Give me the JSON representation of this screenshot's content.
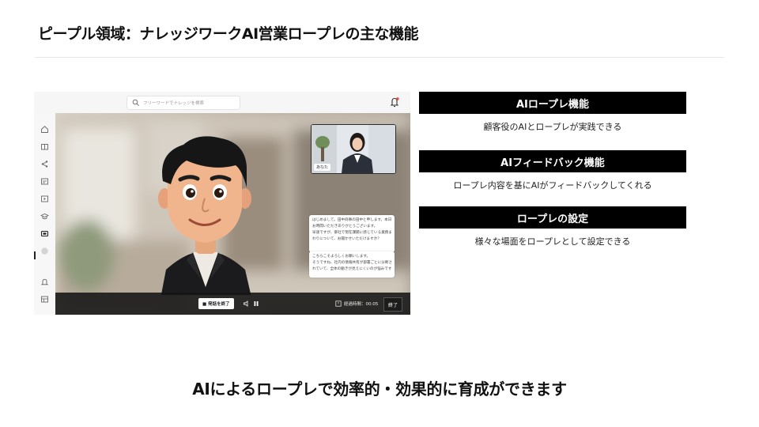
{
  "slide": {
    "title": "ピープル領域：ナレッジワークAI営業ロープレの主な機能",
    "bottom_message": "AIによるロープレで効率的・効果的に育成ができます"
  },
  "app": {
    "search_placeholder": "フリーワードでナレッジを検索",
    "sidebar_icons": [
      "home-icon",
      "book-icon",
      "share-icon",
      "list-icon",
      "play-icon",
      "graduation-icon",
      "roleplay-icon",
      "profile-icon",
      "bell-icon",
      "grid-icon"
    ],
    "pip_label": "あなた",
    "chat": {
      "ai_message": [
        "はじめまして。田中商事の田中と申します。本日は",
        "お時間いただきありがとうございます。",
        "早速ですが、御社で現在課題に感じている業務ま",
        "わりについて、お聞かせいただけますか？"
      ],
      "user_message": [
        "こちらこそよろしくお願いします。",
        "そうですね、社内の情報共有が部署ごとに分断さ",
        "れていて、全体の動きが見えにくいのが悩みです。"
      ]
    },
    "controls": {
      "end_talk_label": "■ 発話を終了",
      "timer_label": "経過時間：00:05",
      "finish_label": "終了"
    }
  },
  "features": [
    {
      "title": "AIロープレ機能",
      "description": "顧客役のAIとロープレが実践できる"
    },
    {
      "title": "AIフィードバック機能",
      "description": "ロープレ内容を基にAIがフィードバックしてくれる"
    },
    {
      "title": "ロープレの設定",
      "description": "様々な場面をロープレとして設定できる"
    }
  ],
  "colors": {
    "feature_header_bg": "#000000",
    "controls_bg": "#141414",
    "avatar_suit": "#1b1b1d"
  }
}
